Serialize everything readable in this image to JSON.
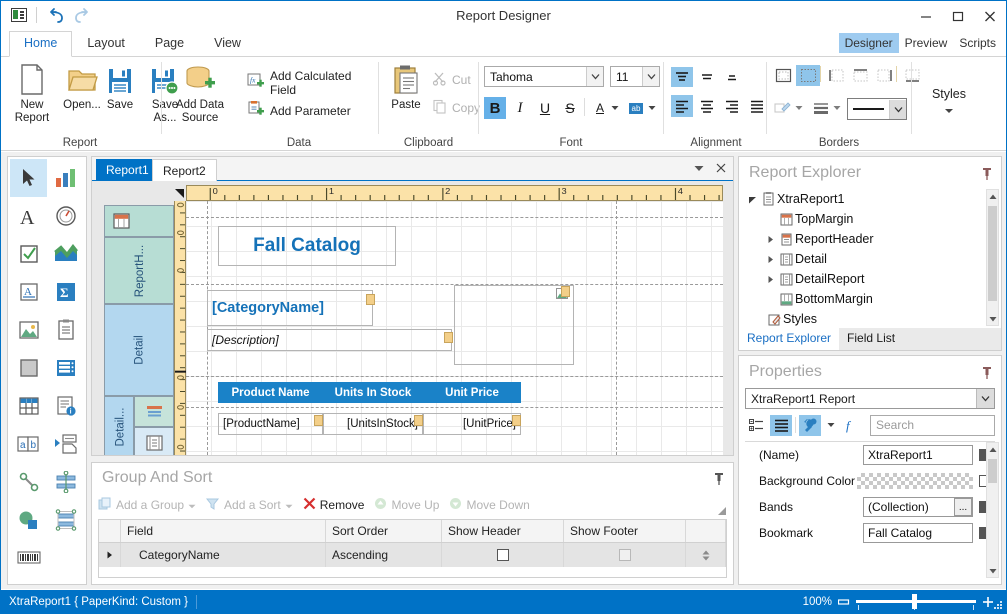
{
  "window": {
    "title": "Report Designer",
    "app_icon": "report-app-icon",
    "quick_access": [
      {
        "name": "undo-button",
        "icon": "undo-arrow-icon"
      },
      {
        "name": "redo-button",
        "icon": "redo-arrow-icon"
      }
    ],
    "controls": [
      {
        "name": "minimize-button",
        "icon": "minimize-icon"
      },
      {
        "name": "maximize-button",
        "icon": "maximize-icon"
      },
      {
        "name": "close-button",
        "icon": "close-icon"
      }
    ]
  },
  "ribbon": {
    "tabs": [
      {
        "label": "Home",
        "active": true
      },
      {
        "label": "Layout",
        "active": false
      },
      {
        "label": "Page",
        "active": false
      },
      {
        "label": "View",
        "active": false
      }
    ],
    "view_switch": [
      {
        "label": "Designer",
        "active": true
      },
      {
        "label": "Preview",
        "active": false
      },
      {
        "label": "Scripts",
        "active": false
      }
    ],
    "groups": {
      "report": {
        "label": "Report",
        "buttons": [
          {
            "label_line1": "New",
            "label_line2": "Report",
            "icon": "new-document-icon"
          },
          {
            "label_line1": "Open...",
            "label_line2": "",
            "icon": "open-folder-icon"
          },
          {
            "label_line1": "Save",
            "label_line2": "",
            "icon": "save-disk-icon"
          },
          {
            "label_line1": "Save",
            "label_line2": "As...",
            "icon": "save-as-disk-icon"
          }
        ]
      },
      "data": {
        "label": "Data",
        "big_button": {
          "label_line1": "Add Data",
          "label_line2": "Source",
          "icon": "database-add-icon"
        },
        "items": [
          {
            "label": "Add Calculated Field",
            "icon": "calculated-field-icon"
          },
          {
            "label": "Add Parameter",
            "icon": "parameter-icon"
          }
        ]
      },
      "clipboard": {
        "label": "Clipboard",
        "paste": {
          "label": "Paste",
          "icon": "paste-clipboard-icon"
        },
        "items": [
          {
            "label": "Cut",
            "icon": "scissors-icon",
            "enabled": false
          },
          {
            "label": "Copy",
            "icon": "copy-pages-icon",
            "enabled": false
          }
        ]
      },
      "font": {
        "label": "Font",
        "family": "Tahoma",
        "size": "11",
        "bold_active": true,
        "buttons": [
          {
            "name": "bold-button",
            "glyph": "B",
            "active": true
          },
          {
            "name": "italic-button",
            "glyph": "I",
            "active": false
          },
          {
            "name": "underline-button",
            "glyph": "U",
            "active": false
          },
          {
            "name": "strikethrough-button",
            "glyph": "S",
            "active": false
          },
          {
            "name": "font-color-button",
            "glyph": "A",
            "active": false
          },
          {
            "name": "highlight-color-button",
            "glyph": "ab",
            "active": false
          }
        ]
      },
      "alignment": {
        "label": "Alignment",
        "vertical": [
          {
            "name": "align-top-button",
            "active": true
          },
          {
            "name": "align-middle-button",
            "active": false
          },
          {
            "name": "align-bottom-button",
            "active": false
          }
        ],
        "horizontal": [
          {
            "name": "align-left-button",
            "active": true
          },
          {
            "name": "align-center-button",
            "active": false
          },
          {
            "name": "align-right-button",
            "active": false
          },
          {
            "name": "align-justify-button",
            "active": false
          }
        ]
      },
      "borders": {
        "label": "Borders",
        "top_row": [
          {
            "name": "border-all-button",
            "active": false
          },
          {
            "name": "border-none-button",
            "active": true
          },
          {
            "name": "border-left-button",
            "active": false
          },
          {
            "name": "border-top-button",
            "active": false
          },
          {
            "name": "border-right-button",
            "active": false
          },
          {
            "name": "border-bottom-button",
            "active": false
          }
        ],
        "bottom_row": [
          {
            "name": "border-color-button"
          },
          {
            "name": "border-width-button"
          },
          {
            "name": "border-style-combo"
          }
        ]
      },
      "styles": {
        "label": "Styles"
      }
    }
  },
  "toolbox": {
    "items": [
      {
        "name": "pointer-tool",
        "icon": "arrow-pointer-icon",
        "selected": true
      },
      {
        "name": "chart-tool",
        "icon": "bar-chart-icon",
        "selected": false
      },
      {
        "name": "label-tool",
        "icon": "label-a-icon",
        "selected": false
      },
      {
        "name": "gauge-tool",
        "icon": "gauge-icon",
        "selected": false
      },
      {
        "name": "check-box-tool",
        "icon": "checkbox-icon",
        "selected": false
      },
      {
        "name": "sparkline-tool",
        "icon": "sparkline-icon",
        "selected": false
      },
      {
        "name": "rich-text-tool",
        "icon": "rich-text-icon",
        "selected": false
      },
      {
        "name": "pivot-grid-tool",
        "icon": "sigma-icon",
        "selected": false
      },
      {
        "name": "picture-box-tool",
        "icon": "picture-icon",
        "selected": false
      },
      {
        "name": "card-tool",
        "icon": "clipboard-list-icon",
        "selected": false
      },
      {
        "name": "panel-tool",
        "icon": "panel-square-icon",
        "selected": false
      },
      {
        "name": "table-of-contents-tool",
        "icon": "table-rows-icon",
        "selected": false
      },
      {
        "name": "table-tool",
        "icon": "table-grid-icon",
        "selected": false
      },
      {
        "name": "page-info-tool",
        "icon": "page-info-icon",
        "selected": false
      },
      {
        "name": "character-comb-tool",
        "icon": "ab-boxes-icon",
        "selected": false
      },
      {
        "name": "subreport-tool",
        "icon": "subreport-icon",
        "selected": false
      },
      {
        "name": "line-tool",
        "icon": "line-segment-icon",
        "selected": false
      },
      {
        "name": "cross-band-line-tool",
        "icon": "cross-band-line-icon",
        "selected": false
      },
      {
        "name": "shape-tool",
        "icon": "shape-circle-square-icon",
        "selected": false
      },
      {
        "name": "cross-band-box-tool",
        "icon": "cross-band-box-icon",
        "selected": false
      },
      {
        "name": "bar-code-tool",
        "icon": "barcode-icon",
        "selected": false
      }
    ]
  },
  "designer": {
    "tabs": [
      {
        "label": "Report1",
        "active": true
      },
      {
        "label": "Report2",
        "active": false
      }
    ],
    "tab_tools": [
      {
        "name": "tab-list-dropdown",
        "icon": "chevron-down-icon"
      },
      {
        "name": "tab-close-button",
        "icon": "close-icon"
      }
    ],
    "ruler": {
      "unit_marks": [
        "0",
        "1",
        "2",
        "3",
        "4"
      ]
    },
    "bands": [
      {
        "label": "",
        "name": "top-margin-band",
        "color": "#b7ddd4",
        "icon": "top-margin-icon"
      },
      {
        "label": "ReportH...",
        "name": "report-header-band",
        "color": "#b7ddd4"
      },
      {
        "label": "Detail",
        "name": "detail-band",
        "color": "#b3d7ef"
      },
      {
        "label": "Detail...",
        "name": "detail-report-band",
        "color": "#b3d7ef"
      }
    ],
    "controls": [
      {
        "name": "report-title-label",
        "text": "Fall Catalog"
      },
      {
        "name": "category-name-label",
        "text": "[CategoryName]"
      },
      {
        "name": "description-label",
        "text": "[Description]"
      },
      {
        "name": "picture-box-control",
        "text": ""
      },
      {
        "name": "product-name-header",
        "text": "Product Name"
      },
      {
        "name": "units-in-stock-header",
        "text": "Units In Stock"
      },
      {
        "name": "unit-price-header",
        "text": "Unit Price"
      },
      {
        "name": "product-name-field",
        "text": "[ProductName]"
      },
      {
        "name": "units-in-stock-field",
        "text": "[UnitsInStock]"
      },
      {
        "name": "unit-price-field",
        "text": "[UnitPrice]"
      }
    ]
  },
  "group_and_sort": {
    "title": "Group And Sort",
    "pin_icon": "pin-icon",
    "toolbar": [
      {
        "label": "Add a Group",
        "icon": "add-group-icon",
        "enabled": false,
        "has_dropdown": true
      },
      {
        "label": "Add a Sort",
        "icon": "add-sort-icon",
        "enabled": false,
        "has_dropdown": true
      },
      {
        "label": "Remove",
        "icon": "remove-x-icon",
        "enabled": true,
        "has_dropdown": false
      },
      {
        "label": "Move Up",
        "icon": "move-up-icon",
        "enabled": false,
        "has_dropdown": false
      },
      {
        "label": "Move Down",
        "icon": "move-down-icon",
        "enabled": false,
        "has_dropdown": false
      }
    ],
    "columns": [
      "Field",
      "Sort Order",
      "Show Header",
      "Show Footer"
    ],
    "rows": [
      {
        "field": "CategoryName",
        "sort_order": "Ascending",
        "show_header": false,
        "show_footer": false
      }
    ]
  },
  "report_explorer": {
    "title": "Report Explorer",
    "pin_icon": "pin-icon",
    "tree": [
      {
        "label": "XtraReport1",
        "depth": 0,
        "expander": "collapse",
        "icon": "report-icon"
      },
      {
        "label": "TopMargin",
        "depth": 1,
        "expander": "none",
        "icon": "top-margin-icon"
      },
      {
        "label": "ReportHeader",
        "depth": 1,
        "expander": "expand",
        "icon": "report-header-icon"
      },
      {
        "label": "Detail",
        "depth": 1,
        "expander": "expand",
        "icon": "detail-band-icon"
      },
      {
        "label": "DetailReport",
        "depth": 1,
        "expander": "expand",
        "icon": "detail-report-icon"
      },
      {
        "label": "BottomMargin",
        "depth": 1,
        "expander": "none",
        "icon": "bottom-margin-icon"
      },
      {
        "label": "Styles",
        "depth": 0,
        "expander": "none",
        "icon": "styles-pencil-icon"
      }
    ],
    "tabs": [
      {
        "label": "Report Explorer",
        "active": true
      },
      {
        "label": "Field List",
        "active": false
      }
    ]
  },
  "properties": {
    "title": "Properties",
    "pin_icon": "pin-icon",
    "object_combo": "XtraReport1  Report",
    "toolbar": [
      {
        "name": "categorized-view-button",
        "icon": "categorized-icon",
        "active": false
      },
      {
        "name": "alphabetical-view-button",
        "icon": "alphabetical-list-icon",
        "active": true
      },
      {
        "name": "properties-button",
        "icon": "wrench-icon",
        "active": true
      },
      {
        "name": "properties-dropdown",
        "icon": "chevron-down-icon",
        "active": false
      },
      {
        "name": "expressions-button",
        "icon": "function-f-icon",
        "active": false
      }
    ],
    "search_placeholder": "Search",
    "search_value": "",
    "rows": [
      {
        "name": "(Name)",
        "value": "XtraReport1",
        "type": "text",
        "marker": "filled"
      },
      {
        "name": "Background Color",
        "value": "",
        "type": "color",
        "marker": "hollow"
      },
      {
        "name": "Bands",
        "value": "(Collection)",
        "type": "collection",
        "marker": "filled"
      },
      {
        "name": "Bookmark",
        "value": "Fall Catalog",
        "type": "text",
        "marker": "filled"
      }
    ]
  },
  "status_bar": {
    "text": "XtraReport1 { PaperKind: Custom }",
    "zoom_label": "100%",
    "zoom_minus_icon": "zoom-out-icon",
    "zoom_plus_icon": "zoom-in-icon"
  }
}
